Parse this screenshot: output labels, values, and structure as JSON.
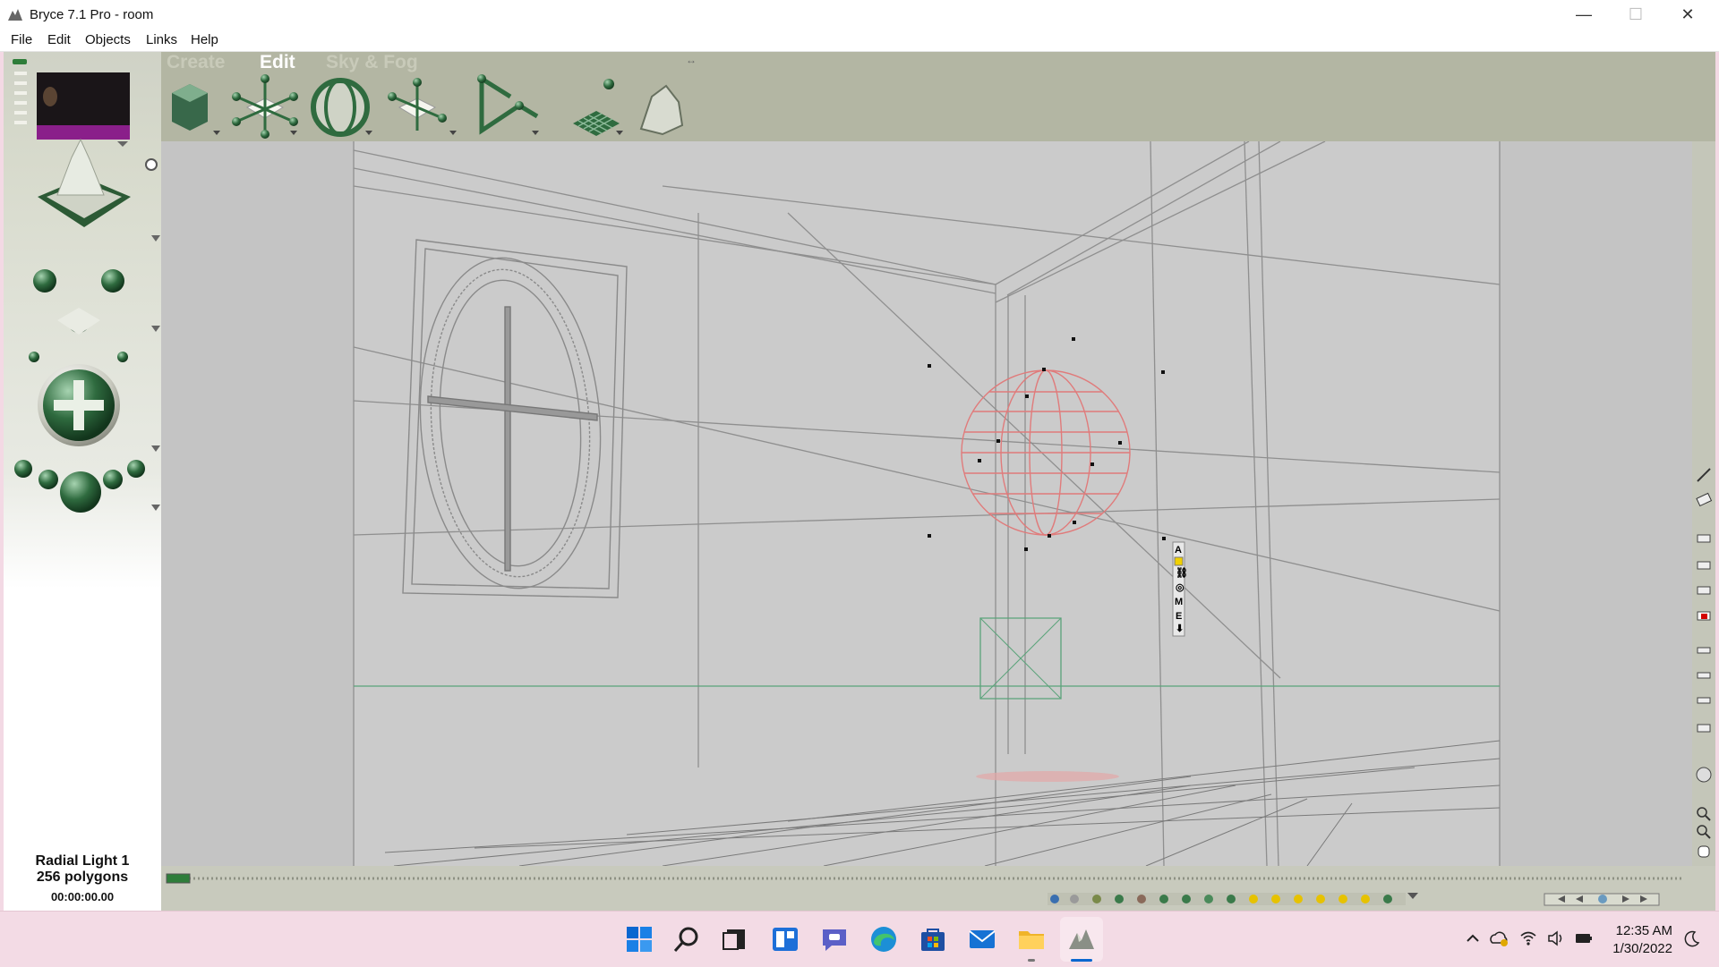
{
  "window": {
    "title": "Bryce 7.1  Pro - room",
    "minimize": "—",
    "maximize": "☐",
    "close": "✕"
  },
  "menu": [
    "File",
    "Edit",
    "Objects",
    "Links",
    "Help"
  ],
  "tabs": {
    "create": "Create",
    "edit": "Edit",
    "sky_fog": "Sky & Fog"
  },
  "toolbar": {
    "tools": [
      "terrain-cube-tool",
      "light-tool",
      "sphere-torus-tool",
      "radial-light-tool",
      "path-tool",
      "grid-object-tool",
      "rock-tool"
    ]
  },
  "gizmo_labels": [
    "A",
    "M",
    "E"
  ],
  "status": {
    "object_name": "Radial Light 1",
    "polygons": "256 polygons",
    "timecode": "00:00:00.00"
  },
  "taskbar": {
    "apps": [
      "start",
      "search",
      "task-view",
      "widgets",
      "teams",
      "edge",
      "store",
      "mail",
      "file-explorer",
      "bryce"
    ],
    "time": "12:35 AM",
    "date": "1/30/2022"
  },
  "colors": {
    "viewport": "#c9c9c9",
    "selected_wireframe": "#e07b7b",
    "ui_green": "#2f6b3f",
    "taskbar": "#f3dbe5"
  }
}
